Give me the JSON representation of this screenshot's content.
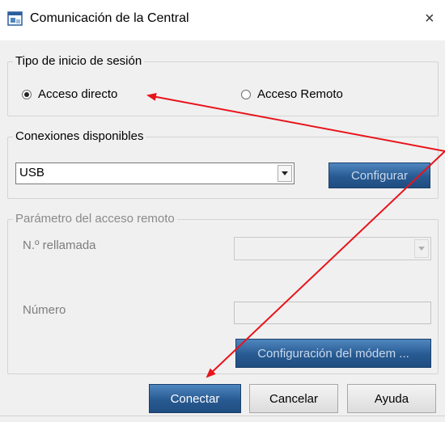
{
  "window": {
    "title": "Comunicación de la Central",
    "close_glyph": "×",
    "icon": "app-window-icon"
  },
  "session_type": {
    "legend": "Tipo de inicio de sesión",
    "options": [
      {
        "label": "Acceso directo",
        "selected": true
      },
      {
        "label": "Acceso Remoto",
        "selected": false
      }
    ]
  },
  "connections": {
    "legend": "Conexiones disponibles",
    "selected_value": "USB",
    "configure_label": "Configurar"
  },
  "remote_params": {
    "legend": "Parámetro del acceso remoto",
    "redial_label": "N.º rellamada",
    "redial_value": "",
    "number_label": "Número",
    "number_value": "",
    "modem_button_label": "Configuración del módem ..."
  },
  "footer": {
    "connect_label": "Conectar",
    "cancel_label": "Cancelar",
    "help_label": "Ayuda"
  },
  "colors": {
    "annotation_arrow": "#e8141b",
    "primary_button": "#285a92"
  }
}
